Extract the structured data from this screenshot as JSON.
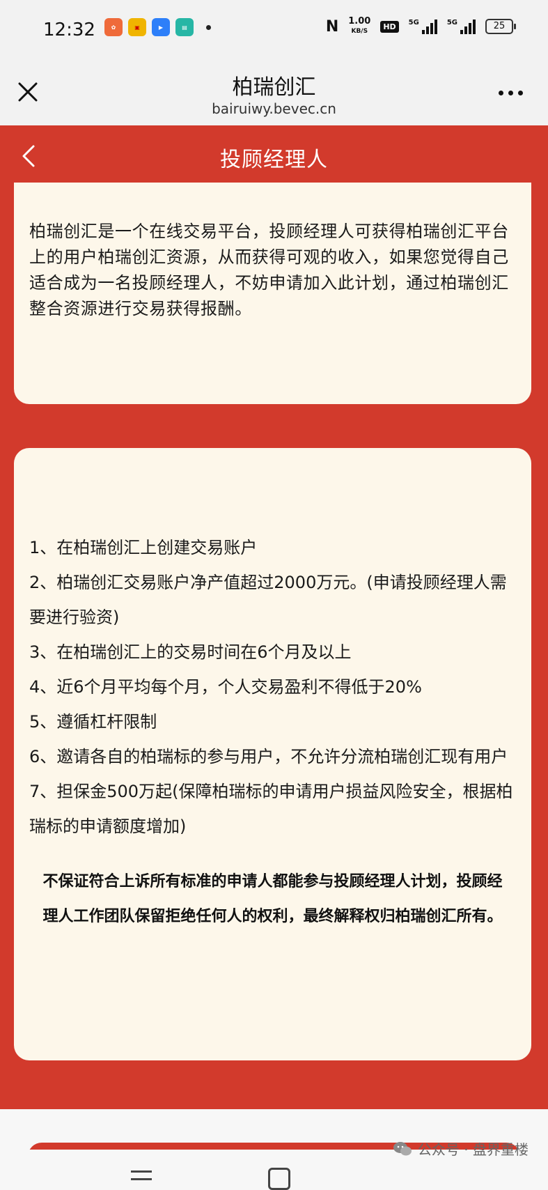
{
  "status_bar": {
    "time": "12:32",
    "network_speed_value": "1.00",
    "network_speed_unit": "KB/S",
    "hd_label": "HD",
    "signal_label_1": "5G",
    "signal_label_2": "5G",
    "battery": "25"
  },
  "browser": {
    "title": "柏瑞创汇",
    "url": "bairuiwy.bevec.cn"
  },
  "page": {
    "title": "投顾经理人"
  },
  "intro": {
    "text": "柏瑞创汇是一个在线交易平台，投顾经理人可获得柏瑞创汇平台上的用户柏瑞创汇资源，从而获得可观的收入，如果您觉得自己适合成为一名投顾经理人，不妨申请加入此计划，通过柏瑞创汇整合资源进行交易获得报酬。"
  },
  "requirements": [
    "1、在柏瑞创汇上创建交易账户",
    "2、柏瑞创汇交易账户净产值超过2000万元。(申请投顾经理人需要进行验资)",
    "3、在柏瑞创汇上的交易时间在6个月及以上",
    "4、近6个月平均每个月，个人交易盈利不得低于20%",
    "5、遵循杠杆限制",
    "6、邀请各自的柏瑞标的参与用户，不允许分流柏瑞创汇现有用户",
    "7、担保金500万起(保障柏瑞标的申请用户损益风险安全，根据柏瑞标的申请额度增加)"
  ],
  "notice": "不保证符合上诉所有标准的申请人都能参与投顾经理人计划，投顾经理人工作团队保留拒绝任何人的权利，最终解释权归柏瑞创汇所有。",
  "watermark": "公众号 · 盘界重楼",
  "icons": {
    "close": "close-icon",
    "more": "more-icon",
    "back": "back-icon",
    "wechat": "wechat-icon"
  },
  "colors": {
    "accent_red": "#d23a2c",
    "card_bg": "#fdf7ea"
  }
}
